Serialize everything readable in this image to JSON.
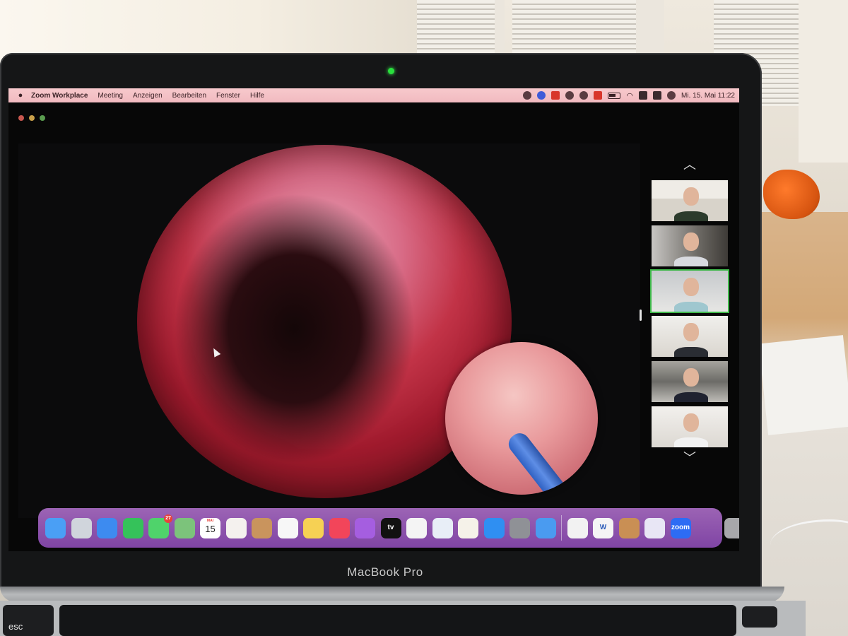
{
  "menubar": {
    "app_name": "Zoom Workplace",
    "items": [
      "Meeting",
      "Anzeigen",
      "Bearbeiten",
      "Fenster",
      "Hilfe"
    ],
    "clock": "Mi. 15. Mai  11:22",
    "zoom_status_icon": "zm"
  },
  "device": {
    "brand": "MacBook Pro",
    "esc_key": "esc"
  },
  "dock": {
    "apps": [
      {
        "name": "Finder",
        "icon": "finder-icon",
        "color": "#4a9ff5"
      },
      {
        "name": "Launchpad",
        "icon": "launchpad-icon",
        "color": "#d0d5dc"
      },
      {
        "name": "Safari",
        "icon": "safari-icon",
        "color": "#3d8bf0"
      },
      {
        "name": "FaceTime",
        "icon": "facetime-icon",
        "color": "#35c25a"
      },
      {
        "name": "Messages",
        "icon": "messages-icon",
        "color": "#4fd36b",
        "badge": "27"
      },
      {
        "name": "Maps",
        "icon": "maps-icon",
        "color": "#7cc37b"
      },
      {
        "name": "Calendar",
        "icon": "calendar-icon",
        "color": "#ffffff",
        "month": "MAI",
        "day": "15"
      },
      {
        "name": "Photos",
        "icon": "photos-icon",
        "color": "#f4f1ee"
      },
      {
        "name": "Contacts",
        "icon": "contacts-icon",
        "color": "#c9945d"
      },
      {
        "name": "Reminders",
        "icon": "reminders-icon",
        "color": "#f7f7f7"
      },
      {
        "name": "Notes",
        "icon": "notes-icon",
        "color": "#f6d154"
      },
      {
        "name": "Music",
        "icon": "music-icon",
        "color": "#f2455a"
      },
      {
        "name": "Podcasts",
        "icon": "podcasts-icon",
        "color": "#a55ee0"
      },
      {
        "name": "TV",
        "icon": "tv-icon",
        "color": "#111111",
        "label": "tv"
      },
      {
        "name": "Numbers",
        "icon": "numbers-icon",
        "color": "#f4f4f4"
      },
      {
        "name": "Keynote",
        "icon": "keynote-icon",
        "color": "#e8eef7"
      },
      {
        "name": "Pages",
        "icon": "pages-icon",
        "color": "#f5f2e9"
      },
      {
        "name": "App Store",
        "icon": "app-store-icon",
        "color": "#2f8ff2"
      },
      {
        "name": "System Settings",
        "icon": "system-settings-icon",
        "color": "#8f9196"
      },
      {
        "name": "Mail",
        "icon": "mail-icon",
        "color": "#4a9bf0"
      }
    ],
    "recent_apps": [
      {
        "name": "PowerPoint",
        "icon": "powerpoint-icon",
        "color": "#f2f2f2"
      },
      {
        "name": "Word",
        "icon": "word-icon",
        "color": "#f5f5f5",
        "label": "W"
      },
      {
        "name": "Party",
        "icon": "party-icon",
        "color": "#c98f54"
      },
      {
        "name": "iMovie",
        "icon": "star-icon",
        "color": "#e8e6f5"
      },
      {
        "name": "Zoom",
        "icon": "zoom-icon",
        "color": "#2d6cf4",
        "label": "zoom"
      }
    ],
    "trash_icon": "trash-icon"
  },
  "zoom_window": {
    "share_cursor_icon": "cursor-arrow",
    "participants": [
      {
        "id": "participant-1",
        "active": false
      },
      {
        "id": "participant-2",
        "active": false
      },
      {
        "id": "participant-3",
        "active": true
      },
      {
        "id": "participant-4",
        "active": false
      },
      {
        "id": "participant-5",
        "active": false
      },
      {
        "id": "participant-6",
        "active": false
      }
    ],
    "active_speaker_color": "#3fb84a"
  }
}
